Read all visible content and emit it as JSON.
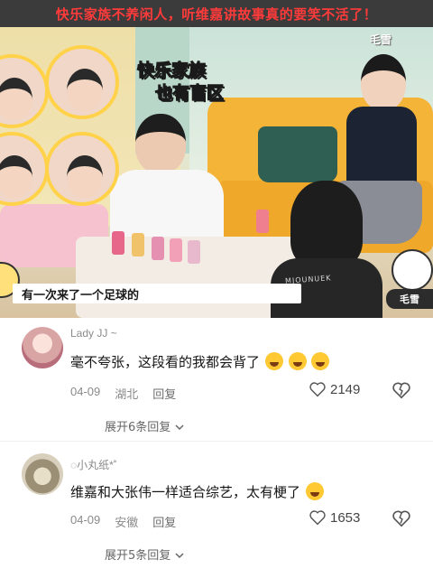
{
  "video": {
    "title": "快乐家族不养闲人，听维嘉讲故事真的要笑不活了！",
    "caption_line1": "快乐家族",
    "caption_line2": "也有盲区",
    "subtitle": "有一次来了一个足球的",
    "logo": "毛雪",
    "watermark": "MJOUNUEK",
    "brand_tag": "毛雪"
  },
  "comments": [
    {
      "username": "Lady JJ ~",
      "text": "毫不夸张，这段看的我都会背了",
      "emoji": [
        "crying-laugh",
        "crying-laugh",
        "crying-laugh"
      ],
      "date": "04-09",
      "location": "湖北",
      "reply_label": "回复",
      "likes": "2149",
      "expand_label": "展开6条回复"
    },
    {
      "username": "◌小丸纸*˚",
      "text": "维嘉和大张伟一样适合综艺，太有梗了",
      "emoji": [
        "sweat-smile"
      ],
      "date": "04-09",
      "location": "安徽",
      "reply_label": "回复",
      "likes": "1653",
      "expand_label": "展开5条回复"
    }
  ],
  "colors": {
    "title": "#ff3a3a",
    "sofa": "#f3b437",
    "caption": "#fff7a8"
  }
}
